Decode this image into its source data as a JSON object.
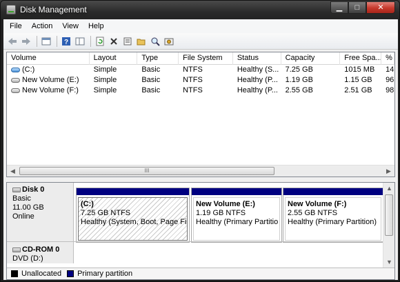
{
  "window": {
    "title": "Disk Management"
  },
  "caption_buttons": {
    "minimize": "▁",
    "maximize": "□",
    "close": "✕"
  },
  "menu": [
    "File",
    "Action",
    "View",
    "Help"
  ],
  "toolbar": {
    "icons": [
      "back-arrow-icon",
      "forward-arrow-icon",
      "console-tree-icon",
      "help-icon",
      "show-pane-icon",
      "refresh-icon",
      "delete-icon",
      "properties-icon",
      "open-folder-icon",
      "search-icon",
      "settings-icon"
    ]
  },
  "volume_list": {
    "columns": [
      "Volume",
      "Layout",
      "Type",
      "File System",
      "Status",
      "Capacity",
      "Free Spa...",
      "% F"
    ],
    "rows": [
      {
        "volume": "(C:)",
        "layout": "Simple",
        "type": "Basic",
        "fs": "NTFS",
        "status": "Healthy (S...",
        "capacity": "7.25 GB",
        "free": "1015 MB",
        "pct": "14"
      },
      {
        "volume": "New Volume (E:)",
        "layout": "Simple",
        "type": "Basic",
        "fs": "NTFS",
        "status": "Healthy (P...",
        "capacity": "1.19 GB",
        "free": "1.15 GB",
        "pct": "96"
      },
      {
        "volume": "New Volume (F:)",
        "layout": "Simple",
        "type": "Basic",
        "fs": "NTFS",
        "status": "Healthy (P...",
        "capacity": "2.55 GB",
        "free": "2.51 GB",
        "pct": "98"
      }
    ],
    "scroll_grip": "III"
  },
  "disks": [
    {
      "name": "Disk 0",
      "type": "Basic",
      "size": "11.00 GB",
      "state": "Online",
      "partitions": [
        {
          "name": "(C:)",
          "size": "7.25 GB NTFS",
          "status": "Healthy (System, Boot, Page File"
        },
        {
          "name": "New Volume  (E:)",
          "size": "1.19 GB NTFS",
          "status": "Healthy (Primary Partitio"
        },
        {
          "name": "New Volume  (F:)",
          "size": "2.55 GB NTFS",
          "status": "Healthy (Primary Partition)"
        }
      ]
    },
    {
      "name": "CD-ROM 0",
      "type": "DVD (D:)"
    }
  ],
  "legend": {
    "unallocated": "Unallocated",
    "primary": "Primary partition",
    "unallocated_color": "#000000",
    "primary_color": "#000080"
  }
}
